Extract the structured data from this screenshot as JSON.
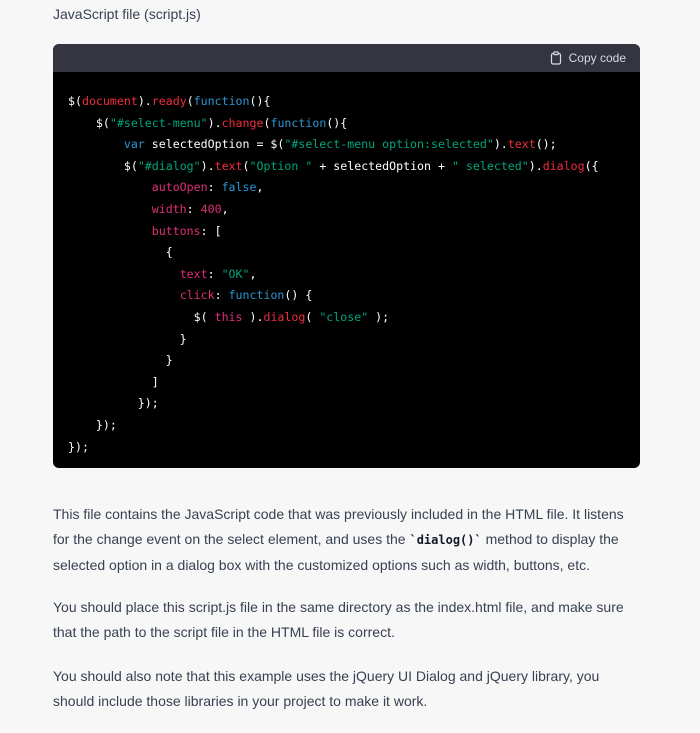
{
  "file_title": "JavaScript file (script.js)",
  "code_block": {
    "copy_label": "Copy code",
    "copy_icon": "clipboard-icon",
    "lines": [
      [
        {
          "t": "plain",
          "v": "$("
        },
        {
          "t": "fn",
          "v": "document"
        },
        {
          "t": "plain",
          "v": ")."
        },
        {
          "t": "fn",
          "v": "ready"
        },
        {
          "t": "plain",
          "v": "("
        },
        {
          "t": "kw",
          "v": "function"
        },
        {
          "t": "plain",
          "v": "(){"
        }
      ],
      [
        {
          "t": "plain",
          "v": "    $("
        },
        {
          "t": "str",
          "v": "\"#select-menu\""
        },
        {
          "t": "plain",
          "v": ")."
        },
        {
          "t": "fn",
          "v": "change"
        },
        {
          "t": "plain",
          "v": "("
        },
        {
          "t": "kw",
          "v": "function"
        },
        {
          "t": "plain",
          "v": "(){"
        }
      ],
      [
        {
          "t": "plain",
          "v": "        "
        },
        {
          "t": "kw",
          "v": "var"
        },
        {
          "t": "plain",
          "v": " selectedOption = $("
        },
        {
          "t": "str",
          "v": "\"#select-menu option:selected\""
        },
        {
          "t": "plain",
          "v": ")."
        },
        {
          "t": "fn",
          "v": "text"
        },
        {
          "t": "plain",
          "v": "();"
        }
      ],
      [
        {
          "t": "plain",
          "v": "        $("
        },
        {
          "t": "str",
          "v": "\"#dialog\""
        },
        {
          "t": "plain",
          "v": ")."
        },
        {
          "t": "fn",
          "v": "text"
        },
        {
          "t": "plain",
          "v": "("
        },
        {
          "t": "str",
          "v": "\"Option \""
        },
        {
          "t": "plain",
          "v": " + selectedOption + "
        },
        {
          "t": "str",
          "v": "\" selected\""
        },
        {
          "t": "plain",
          "v": ")."
        },
        {
          "t": "fn",
          "v": "dialog"
        },
        {
          "t": "plain",
          "v": "({"
        }
      ],
      [
        {
          "t": "plain",
          "v": "            "
        },
        {
          "t": "prop",
          "v": "autoOpen"
        },
        {
          "t": "plain",
          "v": ": "
        },
        {
          "t": "bool",
          "v": "false"
        },
        {
          "t": "plain",
          "v": ","
        }
      ],
      [
        {
          "t": "plain",
          "v": "            "
        },
        {
          "t": "prop",
          "v": "width"
        },
        {
          "t": "plain",
          "v": ": "
        },
        {
          "t": "num",
          "v": "400"
        },
        {
          "t": "plain",
          "v": ","
        }
      ],
      [
        {
          "t": "plain",
          "v": "            "
        },
        {
          "t": "prop",
          "v": "buttons"
        },
        {
          "t": "plain",
          "v": ": ["
        }
      ],
      [
        {
          "t": "plain",
          "v": "              {"
        }
      ],
      [
        {
          "t": "plain",
          "v": "                "
        },
        {
          "t": "prop",
          "v": "text"
        },
        {
          "t": "plain",
          "v": ": "
        },
        {
          "t": "str",
          "v": "\"OK\""
        },
        {
          "t": "plain",
          "v": ","
        }
      ],
      [
        {
          "t": "plain",
          "v": "                "
        },
        {
          "t": "prop",
          "v": "click"
        },
        {
          "t": "plain",
          "v": ": "
        },
        {
          "t": "kw",
          "v": "function"
        },
        {
          "t": "plain",
          "v": "() {"
        }
      ],
      [
        {
          "t": "plain",
          "v": "                  $( "
        },
        {
          "t": "this",
          "v": "this"
        },
        {
          "t": "plain",
          "v": " )."
        },
        {
          "t": "fn",
          "v": "dialog"
        },
        {
          "t": "plain",
          "v": "( "
        },
        {
          "t": "str",
          "v": "\"close\""
        },
        {
          "t": "plain",
          "v": " );"
        }
      ],
      [
        {
          "t": "plain",
          "v": "                }"
        }
      ],
      [
        {
          "t": "plain",
          "v": "              }"
        }
      ],
      [
        {
          "t": "plain",
          "v": "            ]"
        }
      ],
      [
        {
          "t": "plain",
          "v": "          });"
        }
      ],
      [
        {
          "t": "plain",
          "v": "    });"
        }
      ],
      [
        {
          "t": "plain",
          "v": "});"
        }
      ]
    ]
  },
  "paragraphs": {
    "p1_before": "This file contains the JavaScript code that was previously included in the HTML file. It listens for the change event on the select element, and uses the ",
    "p1_code": "`dialog()`",
    "p1_after": " method to display the selected option in a dialog box with the customized options such as width, buttons, etc.",
    "p2": "You should place this script.js file in the same directory as the index.html file, and make sure that the path to the script file in the HTML file is correct.",
    "p3": "You should also note that this example uses the jQuery UI Dialog and jQuery library, you should include those libraries in your project to make it work."
  },
  "colors": {
    "code_bg": "#000000",
    "code_header_bg": "#343541",
    "page_bg": "#f7f7f8",
    "text": "#374151"
  }
}
